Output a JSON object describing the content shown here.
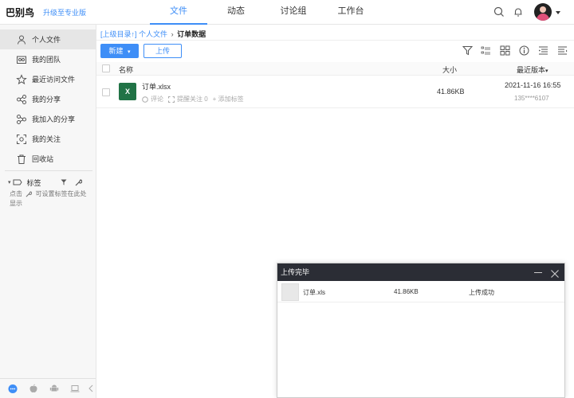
{
  "app": {
    "brand": "巴别鸟",
    "upgrade": "升级至专业版"
  },
  "nav": {
    "tabs": [
      "文件",
      "动态",
      "讨论组",
      "工作台"
    ],
    "active": "文件"
  },
  "sidebar": {
    "items": [
      {
        "label": "个人文件",
        "icon": "user-icon"
      },
      {
        "label": "我的团队",
        "icon": "team-icon"
      },
      {
        "label": "最近访问文件",
        "icon": "star-icon"
      },
      {
        "label": "我的分享",
        "icon": "share-icon"
      },
      {
        "label": "我加入的分享",
        "icon": "joined-share-icon"
      },
      {
        "label": "我的关注",
        "icon": "focus-icon"
      },
      {
        "label": "回收站",
        "icon": "trash-icon"
      }
    ],
    "tags": {
      "title": "标签",
      "hint_prefix": "点击",
      "hint_suffix": "可设置标签在此处显示"
    }
  },
  "breadcrumb": {
    "up": "[上级目录↑]",
    "parent": "个人文件",
    "sep": "›",
    "current": "订单数据"
  },
  "toolbar": {
    "new_label": "新建",
    "new_caret": "▾",
    "upload_label": "上传"
  },
  "table": {
    "columns": {
      "name": "名称",
      "size": "大小",
      "version": "最近版本"
    },
    "sort_caret": "▾",
    "rows": [
      {
        "icon_text": "X",
        "name": "订单.xlsx",
        "comment": "评论",
        "remind": "提醒关注 0",
        "add_tag": "+ 添加标签",
        "size": "41.86KB",
        "date": "2021-11-16 16:55",
        "user": "135****6107"
      }
    ]
  },
  "upload_panel": {
    "title": "上传完毕",
    "items": [
      {
        "name": "订单.xls",
        "size": "41.86KB",
        "status": "上传成功"
      }
    ]
  },
  "colors": {
    "accent": "#3e8ef7",
    "excel": "#217346",
    "panel_header": "#2b2d35"
  }
}
